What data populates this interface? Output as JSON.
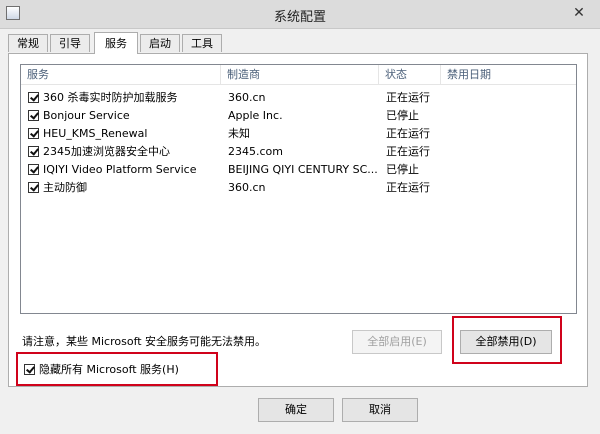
{
  "window": {
    "title": "系统配置",
    "close_glyph": "✕"
  },
  "tabs": [
    {
      "label": "常规"
    },
    {
      "label": "引导"
    },
    {
      "label": "服务",
      "active": true
    },
    {
      "label": "启动"
    },
    {
      "label": "工具"
    }
  ],
  "table": {
    "columns": [
      "服务",
      "制造商",
      "状态",
      "禁用日期"
    ],
    "rows": [
      {
        "service": "360 杀毒实时防护加载服务",
        "manufacturer": "360.cn",
        "status": "正在运行",
        "disabled_date": "",
        "checked": true
      },
      {
        "service": "Bonjour Service",
        "manufacturer": "Apple Inc.",
        "status": "已停止",
        "disabled_date": "",
        "checked": true
      },
      {
        "service": "HEU_KMS_Renewal",
        "manufacturer": "未知",
        "status": "正在运行",
        "disabled_date": "",
        "checked": true
      },
      {
        "service": "2345加速浏览器安全中心",
        "manufacturer": "2345.com",
        "status": "正在运行",
        "disabled_date": "",
        "checked": true
      },
      {
        "service": "IQIYI Video Platform Service",
        "manufacturer": "BEIJING QIYI CENTURY SC...",
        "status": "已停止",
        "disabled_date": "",
        "checked": true
      },
      {
        "service": "主动防御",
        "manufacturer": "360.cn",
        "status": "正在运行",
        "disabled_date": "",
        "checked": true
      }
    ]
  },
  "note": "请注意，某些 Microsoft 安全服务可能无法禁用。",
  "buttons": {
    "enable_all": "全部启用(E)",
    "disable_all": "全部禁用(D)",
    "ok": "确定",
    "cancel": "取消"
  },
  "hide_ms": {
    "label": "隐藏所有 Microsoft 服务(H)",
    "checked": true
  },
  "colors": {
    "highlight": "#d0021b",
    "header_text": "#4c607a"
  }
}
